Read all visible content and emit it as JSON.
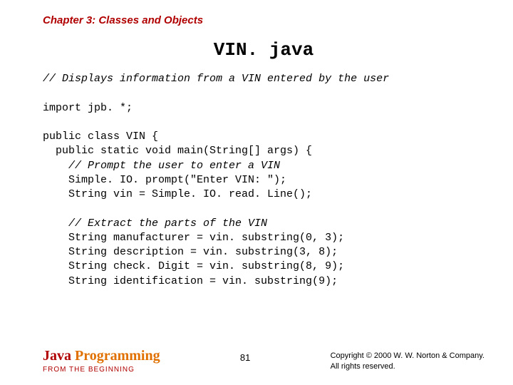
{
  "chapter": "Chapter 3: Classes and Objects",
  "title": "VIN. java",
  "code": {
    "l01": "// Displays information from a VIN entered by the user",
    "l02": "",
    "l03": "import jpb. *;",
    "l04": "",
    "l05": "public class VIN {",
    "l06": "  public static void main(String[] args) {",
    "l07": "    // Prompt the user to enter a VIN",
    "l08": "    Simple. IO. prompt(\"Enter VIN: \");",
    "l09": "    String vin = Simple. IO. read. Line();",
    "l10": "",
    "l11": "    // Extract the parts of the VIN",
    "l12": "    String manufacturer = vin. substring(0, 3);",
    "l13": "    String description = vin. substring(3, 8);",
    "l14": "    String check. Digit = vin. substring(8, 9);",
    "l15": "    String identification = vin. substring(9);"
  },
  "footer": {
    "brand_java": "Java ",
    "brand_prog": "Programming",
    "brand_sub": "FROM THE BEGINNING",
    "page": "81",
    "copyright_l1": "Copyright © 2000 W. W. Norton & Company.",
    "copyright_l2": "All rights reserved."
  }
}
